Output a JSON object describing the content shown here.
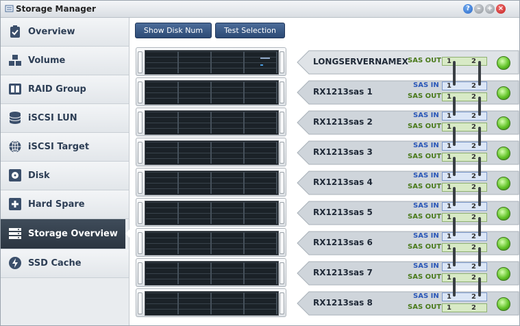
{
  "window": {
    "title": "Storage Manager"
  },
  "title_buttons": [
    "?",
    "–",
    "+",
    "×"
  ],
  "sidebar": {
    "items": [
      {
        "label": "Overview",
        "icon": "clipboard-check-icon"
      },
      {
        "label": "Volume",
        "icon": "stacked-cubes-icon"
      },
      {
        "label": "RAID Group",
        "icon": "raid-group-icon"
      },
      {
        "label": "iSCSI LUN",
        "icon": "database-icon"
      },
      {
        "label": "iSCSI Target",
        "icon": "globe-icon"
      },
      {
        "label": "Disk",
        "icon": "disk-icon"
      },
      {
        "label": "Hard Spare",
        "icon": "plus-box-icon"
      },
      {
        "label": "Storage Overview",
        "icon": "server-list-icon",
        "active": true
      },
      {
        "label": "SSD Cache",
        "icon": "lightning-icon"
      }
    ]
  },
  "toolbar": {
    "show_disk_num": "Show Disk Num",
    "test_selection": "Test Selection"
  },
  "ports": {
    "sas_in": "SAS IN",
    "sas_out": "SAS OUT",
    "p1": "1",
    "p2": "2"
  },
  "hosts": [
    {
      "name": "LONGSERVERNAMEX",
      "type": "server"
    },
    {
      "name": "RX1213sas 1",
      "type": "expansion"
    },
    {
      "name": "RX1213sas 2",
      "type": "expansion"
    },
    {
      "name": "RX1213sas 3",
      "type": "expansion"
    },
    {
      "name": "RX1213sas 4",
      "type": "expansion"
    },
    {
      "name": "RX1213sas 5",
      "type": "expansion"
    },
    {
      "name": "RX1213sas 6",
      "type": "expansion"
    },
    {
      "name": "RX1213sas 7",
      "type": "expansion"
    },
    {
      "name": "RX1213sas 8",
      "type": "expansion"
    }
  ],
  "colors": {
    "accent": "#2c4a75",
    "status_ok": "#64c52a",
    "sidebar_active": "#2b3541"
  }
}
